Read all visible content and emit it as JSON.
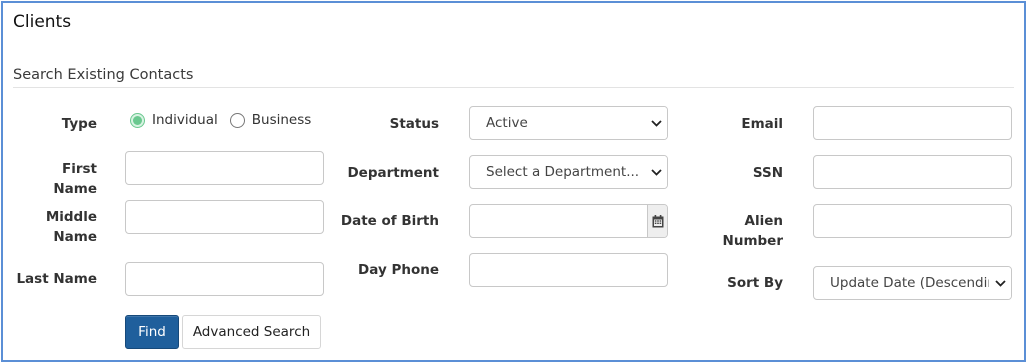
{
  "page": {
    "title": "Clients"
  },
  "section": {
    "title": "Search Existing Contacts"
  },
  "type": {
    "label": "Type",
    "options": [
      {
        "label": "Individual",
        "selected": true
      },
      {
        "label": "Business",
        "selected": false
      }
    ]
  },
  "first_name": {
    "label": "First Name",
    "value": ""
  },
  "middle_name": {
    "label_line1": "Middle",
    "label_line2": "Name",
    "value": ""
  },
  "last_name": {
    "label": "Last Name",
    "value": ""
  },
  "status": {
    "label": "Status",
    "value": "Active"
  },
  "department": {
    "label": "Department",
    "value": "Select a Department..."
  },
  "dob": {
    "label": "Date of Birth",
    "value": ""
  },
  "day_phone": {
    "label": "Day Phone",
    "value": ""
  },
  "email": {
    "label": "Email",
    "value": ""
  },
  "ssn": {
    "label": "SSN",
    "value": ""
  },
  "alien_number": {
    "label_line1": "Alien",
    "label_line2": "Number",
    "value": ""
  },
  "sort_by": {
    "label": "Sort By",
    "value": "Update Date (Descending)"
  },
  "buttons": {
    "find": "Find",
    "advanced_search": "Advanced Search"
  },
  "colors": {
    "frame": "#5b8fd6",
    "primary": "#1f5f9c",
    "radio_accent": "#6ac88f"
  },
  "icons": {
    "calendar": "calendar-icon",
    "chevron": "chevron-down-icon"
  }
}
